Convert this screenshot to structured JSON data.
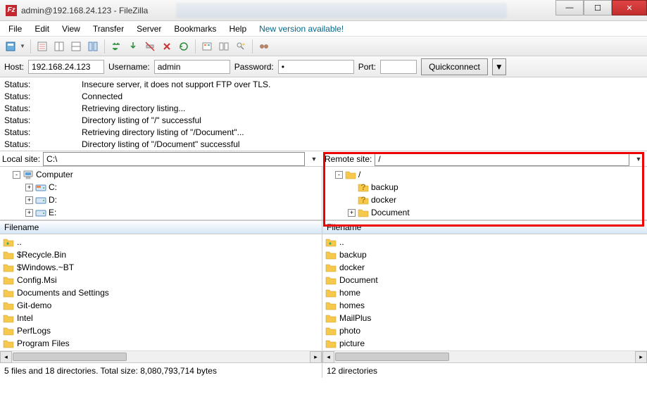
{
  "window": {
    "title": "admin@192.168.24.123 - FileZilla",
    "app_icon_letter": "Fz"
  },
  "menu": {
    "items": [
      "File",
      "Edit",
      "View",
      "Transfer",
      "Server",
      "Bookmarks",
      "Help"
    ],
    "new_version": "New version available!"
  },
  "quickconnect": {
    "host_label": "Host:",
    "host_value": "192.168.24.123",
    "user_label": "Username:",
    "user_value": "admin",
    "pass_label": "Password:",
    "pass_value": "•",
    "port_label": "Port:",
    "port_value": "",
    "button": "Quickconnect"
  },
  "log": [
    {
      "label": "Status:",
      "msg": "Insecure server, it does not support FTP over TLS."
    },
    {
      "label": "Status:",
      "msg": "Connected"
    },
    {
      "label": "Status:",
      "msg": "Retrieving directory listing..."
    },
    {
      "label": "Status:",
      "msg": "Directory listing of \"/\" successful"
    },
    {
      "label": "Status:",
      "msg": "Retrieving directory listing of \"/Document\"..."
    },
    {
      "label": "Status:",
      "msg": "Directory listing of \"/Document\" successful"
    }
  ],
  "local": {
    "site_label": "Local site:",
    "site_value": "C:\\",
    "tree": [
      {
        "level": 1,
        "expander": "-",
        "icon": "computer",
        "label": "Computer"
      },
      {
        "level": 2,
        "expander": "+",
        "icon": "drive-c",
        "label": "C:"
      },
      {
        "level": 2,
        "expander": "+",
        "icon": "drive",
        "label": "D:"
      },
      {
        "level": 2,
        "expander": "+",
        "icon": "drive",
        "label": "E:"
      }
    ],
    "file_header": "Filename",
    "files": [
      {
        "icon": "folder-up",
        "name": ".."
      },
      {
        "icon": "folder",
        "name": "$Recycle.Bin"
      },
      {
        "icon": "folder",
        "name": "$Windows.~BT"
      },
      {
        "icon": "folder",
        "name": "Config.Msi"
      },
      {
        "icon": "folder",
        "name": "Documents and Settings"
      },
      {
        "icon": "folder",
        "name": "Git-demo"
      },
      {
        "icon": "folder",
        "name": "Intel"
      },
      {
        "icon": "folder",
        "name": "PerfLogs"
      },
      {
        "icon": "folder",
        "name": "Program Files"
      }
    ],
    "status": "5 files and 18 directories. Total size: 8,080,793,714 bytes"
  },
  "remote": {
    "site_label": "Remote site:",
    "site_value": "/",
    "tree": [
      {
        "level": 1,
        "expander": "-",
        "icon": "folder",
        "label": "/"
      },
      {
        "level": 2,
        "expander": "",
        "icon": "folder-q",
        "label": "backup"
      },
      {
        "level": 2,
        "expander": "",
        "icon": "folder-q",
        "label": "docker"
      },
      {
        "level": 2,
        "expander": "+",
        "icon": "folder",
        "label": "Document"
      }
    ],
    "file_header": "Filename",
    "files": [
      {
        "icon": "folder-up",
        "name": ".."
      },
      {
        "icon": "folder",
        "name": "backup"
      },
      {
        "icon": "folder",
        "name": "docker"
      },
      {
        "icon": "folder",
        "name": "Document"
      },
      {
        "icon": "folder",
        "name": "home"
      },
      {
        "icon": "folder",
        "name": "homes"
      },
      {
        "icon": "folder",
        "name": "MailPlus"
      },
      {
        "icon": "folder",
        "name": "photo"
      },
      {
        "icon": "folder",
        "name": "picture"
      }
    ],
    "status": "12 directories"
  }
}
